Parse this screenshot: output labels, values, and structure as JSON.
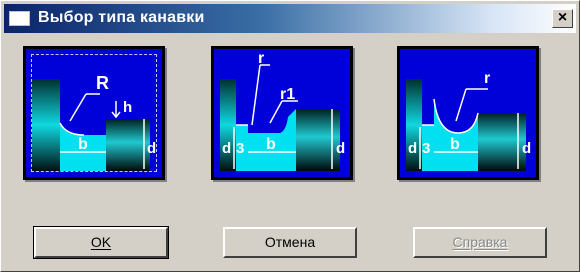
{
  "window": {
    "title": "Выбор типа канавки",
    "close_glyph": "×"
  },
  "groove_types": [
    {
      "id": "type-1",
      "selected": true,
      "labels": {
        "radius": "R",
        "depth": "h",
        "width": "b",
        "diameter": "d"
      }
    },
    {
      "id": "type-2",
      "selected": false,
      "labels": {
        "radius": "r",
        "radius2": "r1",
        "depth": "3",
        "width": "b",
        "diameter_small": "d",
        "diameter": "d"
      }
    },
    {
      "id": "type-3",
      "selected": false,
      "labels": {
        "radius": "r",
        "depth": "3",
        "width": "b",
        "diameter_small": "d",
        "diameter": "d"
      }
    }
  ],
  "buttons": {
    "ok": {
      "label": "OK",
      "enabled": true
    },
    "cancel": {
      "label": "Отмена",
      "enabled": true
    },
    "help": {
      "label": "Справка",
      "enabled": false
    }
  },
  "colors": {
    "panel_bg": "#0000d8",
    "groove_fill": "#00e0f0",
    "shaft_dark": "#001818",
    "line": "#ffffff"
  }
}
